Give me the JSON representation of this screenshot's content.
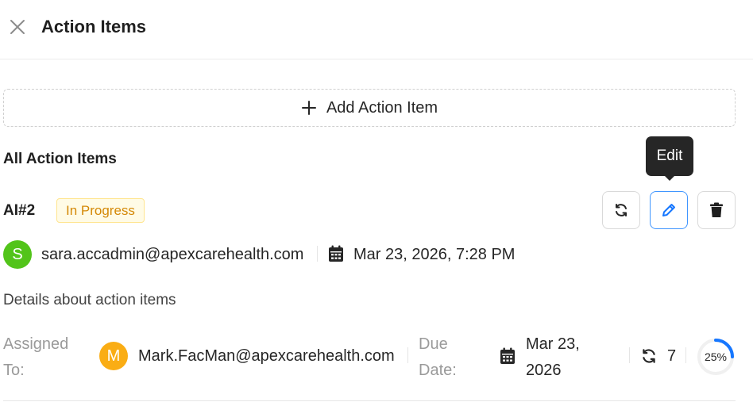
{
  "header": {
    "title": "Action Items"
  },
  "add_button": {
    "label": "Add Action Item"
  },
  "section": {
    "title": "All Action Items"
  },
  "tooltip": {
    "text": "Edit"
  },
  "item": {
    "id": "AI#2",
    "status": "In Progress",
    "creator": {
      "initial": "S",
      "email": "sara.accadmin@apexcarehealth.com",
      "avatar_color": "#52c41a"
    },
    "created_at": "Mar 23, 2026, 7:28 PM",
    "details": "Details about action items",
    "assigned_label_line1": "Assigned",
    "assigned_label_line2": "To:",
    "assignee": {
      "initial": "M",
      "email": "Mark.FacMan@apexcarehealth.com",
      "avatar_color": "#faad14"
    },
    "due_label_line1": "Due",
    "due_label_line2": "Date:",
    "due_date_line1": "Mar 23,",
    "due_date_line2": "2026",
    "recurrence_count": "7",
    "progress_label": "25%",
    "progress_fraction": 0.25
  },
  "colors": {
    "accent": "#1677ff",
    "status_text": "#d48806",
    "status_bg": "#fffbe6",
    "status_border": "#ffe58f"
  },
  "icons": [
    "close-icon",
    "plus-icon",
    "refresh-icon",
    "edit-icon",
    "trash-icon",
    "calendar-icon",
    "repeat-icon"
  ]
}
